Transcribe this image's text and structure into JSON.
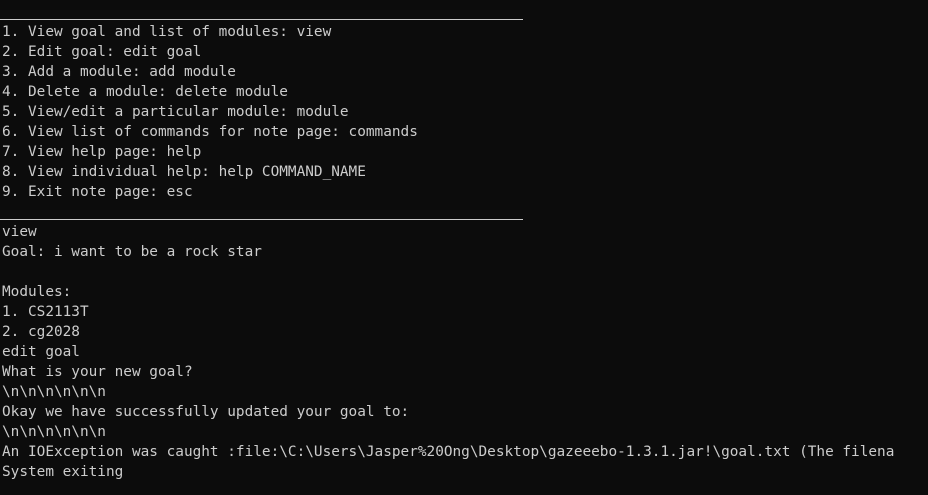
{
  "menu": {
    "items": [
      "1. View goal and list of modules: view",
      "2. Edit goal: edit goal",
      "3. Add a module: add module",
      "4. Delete a module: delete module",
      "5. View/edit a particular module: module",
      "6. View list of commands for note page: commands",
      "7. View help page: help",
      "8. View individual help: help COMMAND_NAME",
      "9. Exit note page: esc"
    ]
  },
  "output": {
    "lines": [
      "view",
      "Goal: i want to be a rock star",
      "",
      "Modules:",
      "1. CS2113T",
      "2. cg2028",
      "edit goal",
      "What is your new goal?",
      "\\n\\n\\n\\n\\n\\n",
      "Okay we have successfully updated your goal to:",
      "\\n\\n\\n\\n\\n\\n",
      "An IOException was caught :file:\\C:\\Users\\Jasper%20Ong\\Desktop\\gazeeebo-1.3.1.jar!\\goal.txt (The filena",
      "System exiting"
    ]
  }
}
